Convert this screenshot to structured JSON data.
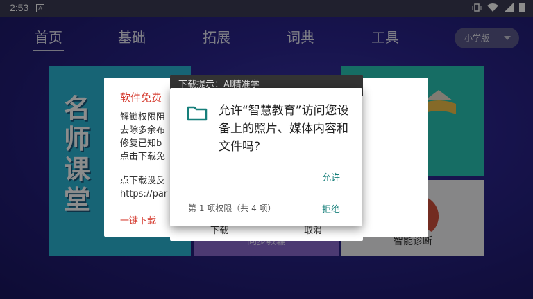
{
  "status": {
    "time": "2:53",
    "notif_icon": "A"
  },
  "nav": {
    "tabs": [
      {
        "label": "首页"
      },
      {
        "label": "基础"
      },
      {
        "label": "拓展"
      },
      {
        "label": "词典"
      },
      {
        "label": "工具"
      }
    ],
    "level_select": "小学版"
  },
  "tiles": {
    "famous": "名师课堂",
    "sync": "同步教辅",
    "diagnose": "智能诊断"
  },
  "update_dialog": {
    "title": "软件免费",
    "body_lines": "解锁权限阻\n去除多余布\n修复已知b\n点击下载免",
    "body2_lines": "点下载没反\nhttps://par",
    "one_click": "一键下载"
  },
  "download_dialog": {
    "header": "下载提示：AI精准学",
    "download": "下载",
    "cancel": "取消"
  },
  "permission_dialog": {
    "message": "允许“智慧教育”访问您设备上的照片、媒体内容和文件吗?",
    "allow": "允许",
    "count": "第 1 项权限（共 4 项）",
    "deny": "拒绝"
  },
  "colors": {
    "accent": "#167f7a",
    "warning": "#d53a2e"
  }
}
